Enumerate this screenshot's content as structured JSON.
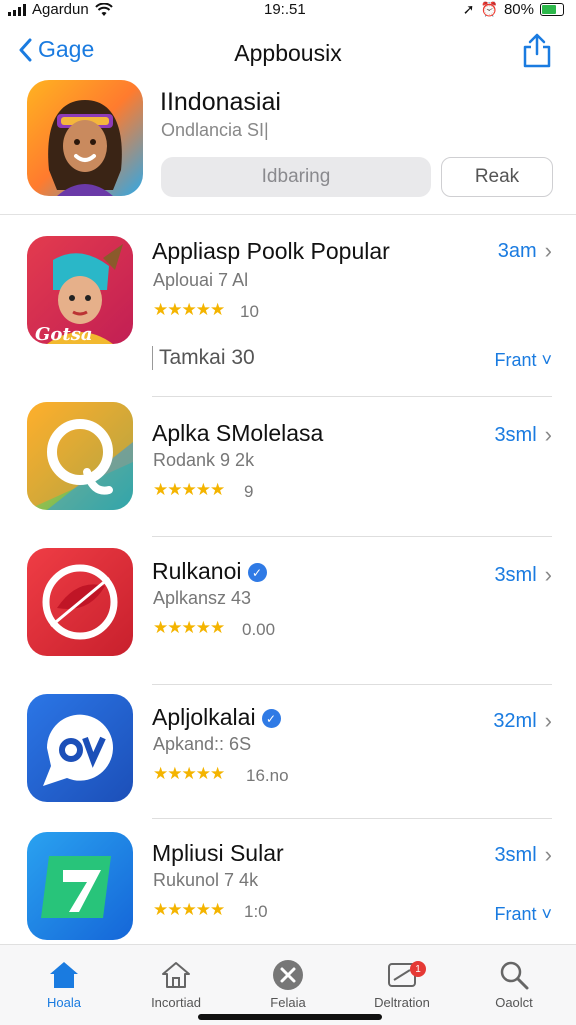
{
  "status": {
    "carrier": "Agardun",
    "time": "19:.51",
    "battery": "80%",
    "battery_level": 0.8
  },
  "nav": {
    "back_label": "Gage",
    "title": "Appbousix"
  },
  "hero": {
    "name": "IIndonasiai",
    "subtitle": "Ondlancia SI|",
    "primary_button": "Idbaring",
    "secondary_button": "Reak"
  },
  "apps": [
    {
      "name": "Appliasp Poolk Popular",
      "subtitle": "Aplouai 7 Al",
      "stars": "★★★★★",
      "rating": "10",
      "size": "3am",
      "extra": "Tamkai 30",
      "more": "Frant",
      "colors": [
        "#e33b4e",
        "#c21f54"
      ]
    },
    {
      "name": "Aplka SMolelasa",
      "subtitle": "Rodank 9 2k",
      "stars": "★★★★★",
      "rating": "9",
      "size": "3sml",
      "colors": [
        "#ffcf2f",
        "#34b16a"
      ]
    },
    {
      "name": "Rulkanoi",
      "subtitle": "Aplkansz 43",
      "stars": "★★★★★",
      "rating": "0.00",
      "size": "3sml",
      "verified": true,
      "colors": [
        "#ef3d45",
        "#c8202d"
      ]
    },
    {
      "name": "Apljolkalai",
      "subtitle": "Apkand:: 6S",
      "stars": "★★★★★",
      "rating": "16.no",
      "size": "32ml",
      "verified": true,
      "colors": [
        "#2b76e6",
        "#1c4fb8"
      ]
    },
    {
      "name": "Mpliusi Sular",
      "subtitle": "Rukunol 7 4k",
      "stars": "★★★★★",
      "rating": "1:0",
      "size": "3sml",
      "more": "Frant",
      "colors": [
        "#2aa2f0",
        "#1566d8"
      ]
    }
  ],
  "tabs": [
    {
      "label": "Hoala",
      "icon": "house-filled-icon",
      "active": true
    },
    {
      "label": "Incortiad",
      "icon": "house-outline-icon"
    },
    {
      "label": "Felaia",
      "icon": "cross-circle-icon"
    },
    {
      "label": "Deltration",
      "icon": "update-tray-icon",
      "badge": "1"
    },
    {
      "label": "Oaolct",
      "icon": "search-icon"
    }
  ]
}
